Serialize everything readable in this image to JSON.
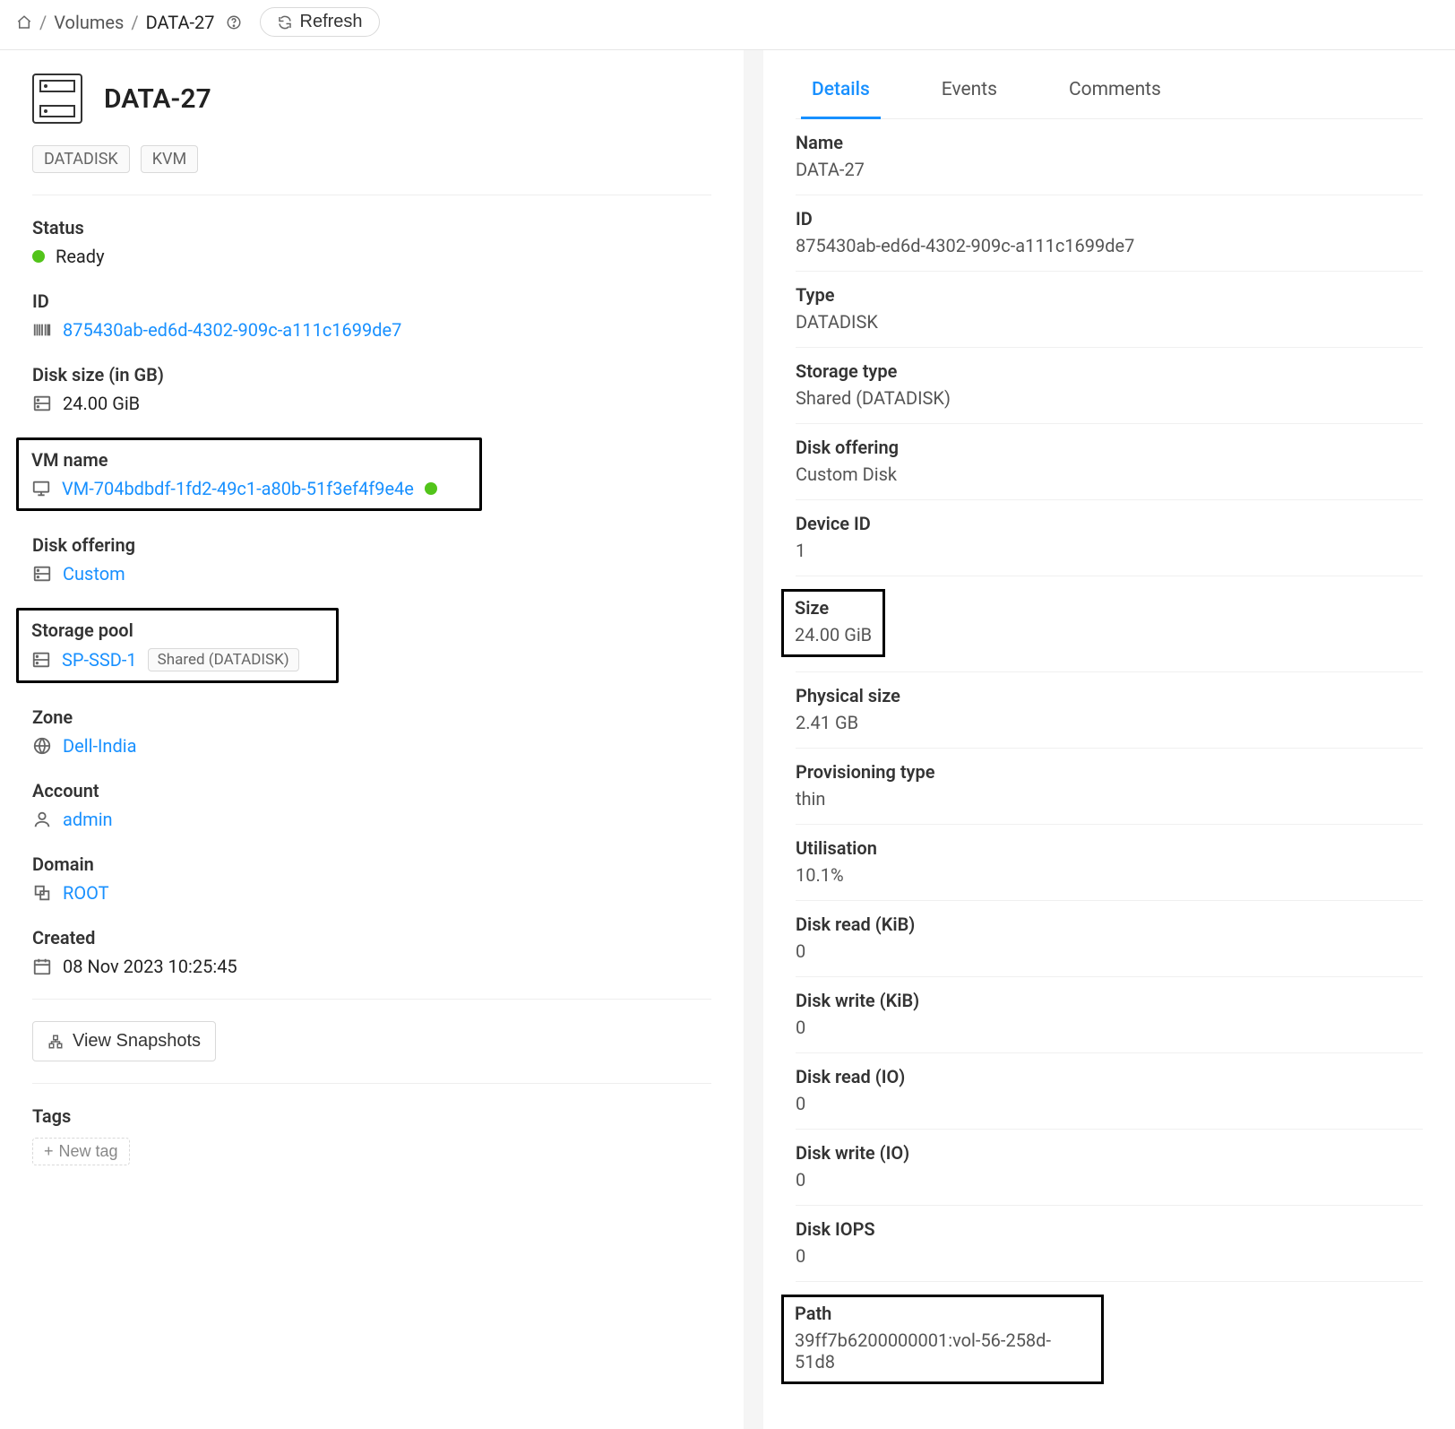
{
  "breadcrumb": {
    "volumes": "Volumes",
    "current": "DATA-27"
  },
  "refresh_label": "Refresh",
  "title": "DATA-27",
  "tags": {
    "datadisk": "DATADISK",
    "kvm": "KVM"
  },
  "left": {
    "status_label": "Status",
    "status_value": "Ready",
    "id_label": "ID",
    "id_value": "875430ab-ed6d-4302-909c-a111c1699de7",
    "disksize_label": "Disk size (in GB)",
    "disksize_value": "24.00 GiB",
    "vmname_label": "VM name",
    "vmname_value": "VM-704bdbdf-1fd2-49c1-a80b-51f3ef4f9e4e",
    "diskoffer_label": "Disk offering",
    "diskoffer_value": "Custom",
    "storagepool_label": "Storage pool",
    "storagepool_value": "SP-SSD-1",
    "storagepool_tag": "Shared (DATADISK)",
    "zone_label": "Zone",
    "zone_value": "Dell-India",
    "account_label": "Account",
    "account_value": "admin",
    "domain_label": "Domain",
    "domain_value": "ROOT",
    "created_label": "Created",
    "created_value": "08 Nov 2023 10:25:45",
    "viewsnapshots_label": "View Snapshots",
    "tags_label": "Tags",
    "newtag_label": "New tag"
  },
  "tabs": {
    "details": "Details",
    "events": "Events",
    "comments": "Comments"
  },
  "details": {
    "name_label": "Name",
    "name_value": "DATA-27",
    "id_label": "ID",
    "id_value": "875430ab-ed6d-4302-909c-a111c1699de7",
    "type_label": "Type",
    "type_value": "DATADISK",
    "storagetype_label": "Storage type",
    "storagetype_value": "Shared (DATADISK)",
    "diskoffer_label": "Disk offering",
    "diskoffer_value": "Custom Disk",
    "deviceid_label": "Device ID",
    "deviceid_value": "1",
    "size_label": "Size",
    "size_value": "24.00 GiB",
    "physicalsize_label": "Physical size",
    "physicalsize_value": "2.41 GB",
    "provtype_label": "Provisioning type",
    "provtype_value": "thin",
    "util_label": "Utilisation",
    "util_value": "10.1%",
    "diskreadkib_label": "Disk read (KiB)",
    "diskreadkib_value": "0",
    "diskwritekib_label": "Disk write (KiB)",
    "diskwritekib_value": "0",
    "diskreadio_label": "Disk read (IO)",
    "diskreadio_value": "0",
    "diskwriteio_label": "Disk write (IO)",
    "diskwriteio_value": "0",
    "diskiops_label": "Disk IOPS",
    "diskiops_value": "0",
    "path_label": "Path",
    "path_value": "39ff7b6200000001:vol-56-258d-51d8"
  }
}
